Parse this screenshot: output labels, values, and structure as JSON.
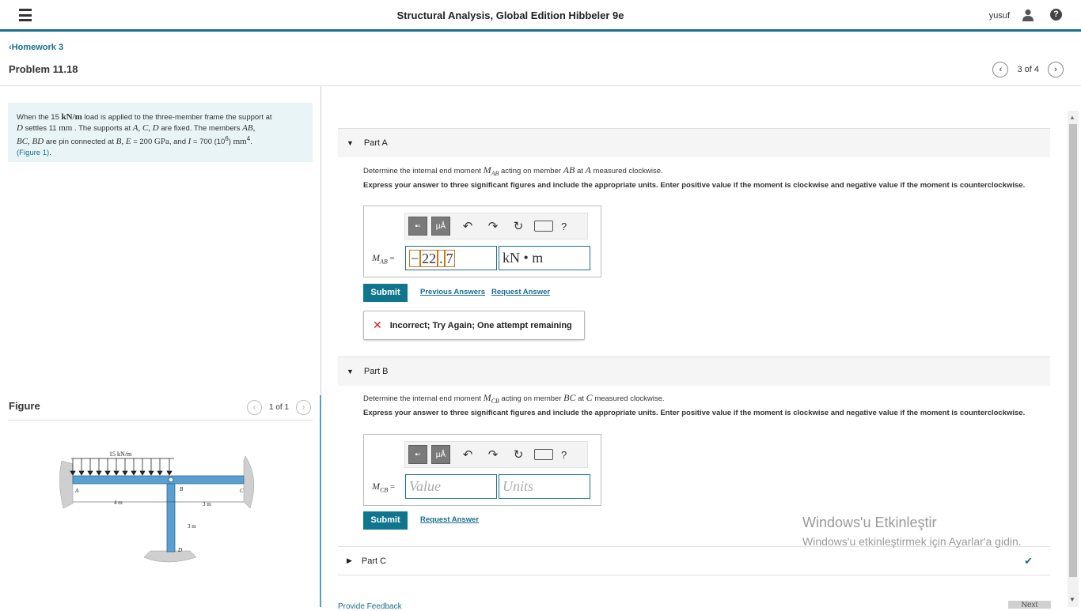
{
  "header": {
    "title": "Structural Analysis, Global Edition Hibbeler 9e",
    "user": "yusuf",
    "help": "?"
  },
  "nav": {
    "back_label": "Homework 3",
    "problem_title": "Problem 11.18",
    "page_indicator": "3 of 4"
  },
  "problem": {
    "text_1": "When the 15 ",
    "load": "kN/m",
    "text_2": " load is applied to the three-member frame the support at",
    "D": "D",
    "text_3": " settles 11 ",
    "mm": "mm",
    "text_4": " . The supports at ",
    "ACD": "A, C, D",
    "text_5": " are fixed. The members ",
    "AB": "AB,",
    "BCBD": "BC, BD",
    "text_6": " are pin connected at ",
    "BEq": "B, E",
    "text_7": " = 200 ",
    "GPa": "GPa",
    "text_8": ", and ",
    "I": "I",
    "text_9": " = 700 (10",
    "exp": "6",
    "text_10": ") ",
    "mm4": "mm",
    "exp4": "4",
    "text_11": ".",
    "figure_link": "(Figure 1)",
    "text_12": "."
  },
  "figure": {
    "heading": "Figure",
    "pager": "1 of 1",
    "load_label": "15 kN/m",
    "labels": {
      "A": "A",
      "B": "B",
      "C": "C",
      "D": "D",
      "dim_4m": "4 m",
      "dim_3m_h": "3 m",
      "dim_3m_v": "3 m"
    }
  },
  "partA": {
    "label": "Part A",
    "question_pre": "Determine the internal end moment ",
    "var": "M",
    "var_sub": "AB",
    "question_mid": " acting on member ",
    "member": "AB",
    "question_at": " at ",
    "point": "A",
    "question_post": " measured clockwise.",
    "instructions": "Express your answer to three significant figures and include the appropriate units. Enter positive value if the moment is clockwise and negative value if the moment is counterclockwise.",
    "answer_label": "M",
    "answer_sub": "AB",
    "answer_eq": " =",
    "value_chars": [
      "−",
      "22",
      ".",
      "7"
    ],
    "units": "kN • m",
    "submit": "Submit",
    "prev_answers": "Previous Answers",
    "request_answer": "Request Answer",
    "feedback": "Incorrect; Try Again; One attempt remaining",
    "feedback_icon": "✕"
  },
  "partB": {
    "label": "Part B",
    "question_pre": "Determine the internal end moment ",
    "var": "M",
    "var_sub": "CB",
    "question_mid": " acting on member ",
    "member": "BC",
    "question_at": " at ",
    "point": "C",
    "question_post": " measured clockwise.",
    "instructions": "Express your answer to three significant figures and include the appropriate units. Enter positive value if the moment is clockwise and negative value if the moment is counterclockwise.",
    "answer_label": "M",
    "answer_sub": "CB",
    "answer_eq": " =",
    "value_placeholder": "Value",
    "units_placeholder": "Units",
    "submit": "Submit",
    "request_answer": "Request Answer"
  },
  "partC": {
    "label": "Part C",
    "check": "✔"
  },
  "toolbar": {
    "mu": "μÅ",
    "undo": "↶",
    "redo": "↷",
    "reset": "↻",
    "help": "?"
  },
  "watermark": {
    "line1": "Windows'u Etkinleştir",
    "line2": "Windows'u etkinleştirmek için Ayarlar'a gidin."
  },
  "footer": {
    "feedback_link": "Provide Feedback",
    "next": "Next"
  }
}
